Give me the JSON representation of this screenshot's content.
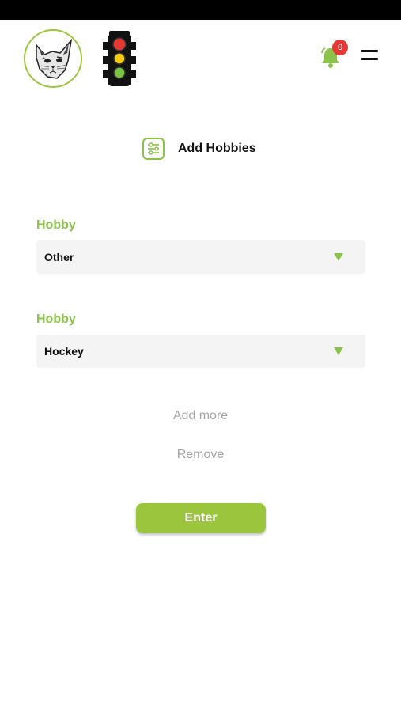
{
  "header": {
    "notification_count": "0",
    "icons": [
      "cat-avatar",
      "traffic-light",
      "bell",
      "menu"
    ]
  },
  "page": {
    "title": "Add Hobbies"
  },
  "hobbies": [
    {
      "label": "Hobby",
      "value": "Other"
    },
    {
      "label": "Hobby",
      "value": "Hockey"
    }
  ],
  "actions": {
    "add_more": "Add more",
    "remove": "Remove",
    "enter": "Enter"
  },
  "colors": {
    "accent": "#9bc53d",
    "badge": "#e53935",
    "field_bg": "#f4f4f4",
    "muted_text": "#a6a6a6"
  }
}
